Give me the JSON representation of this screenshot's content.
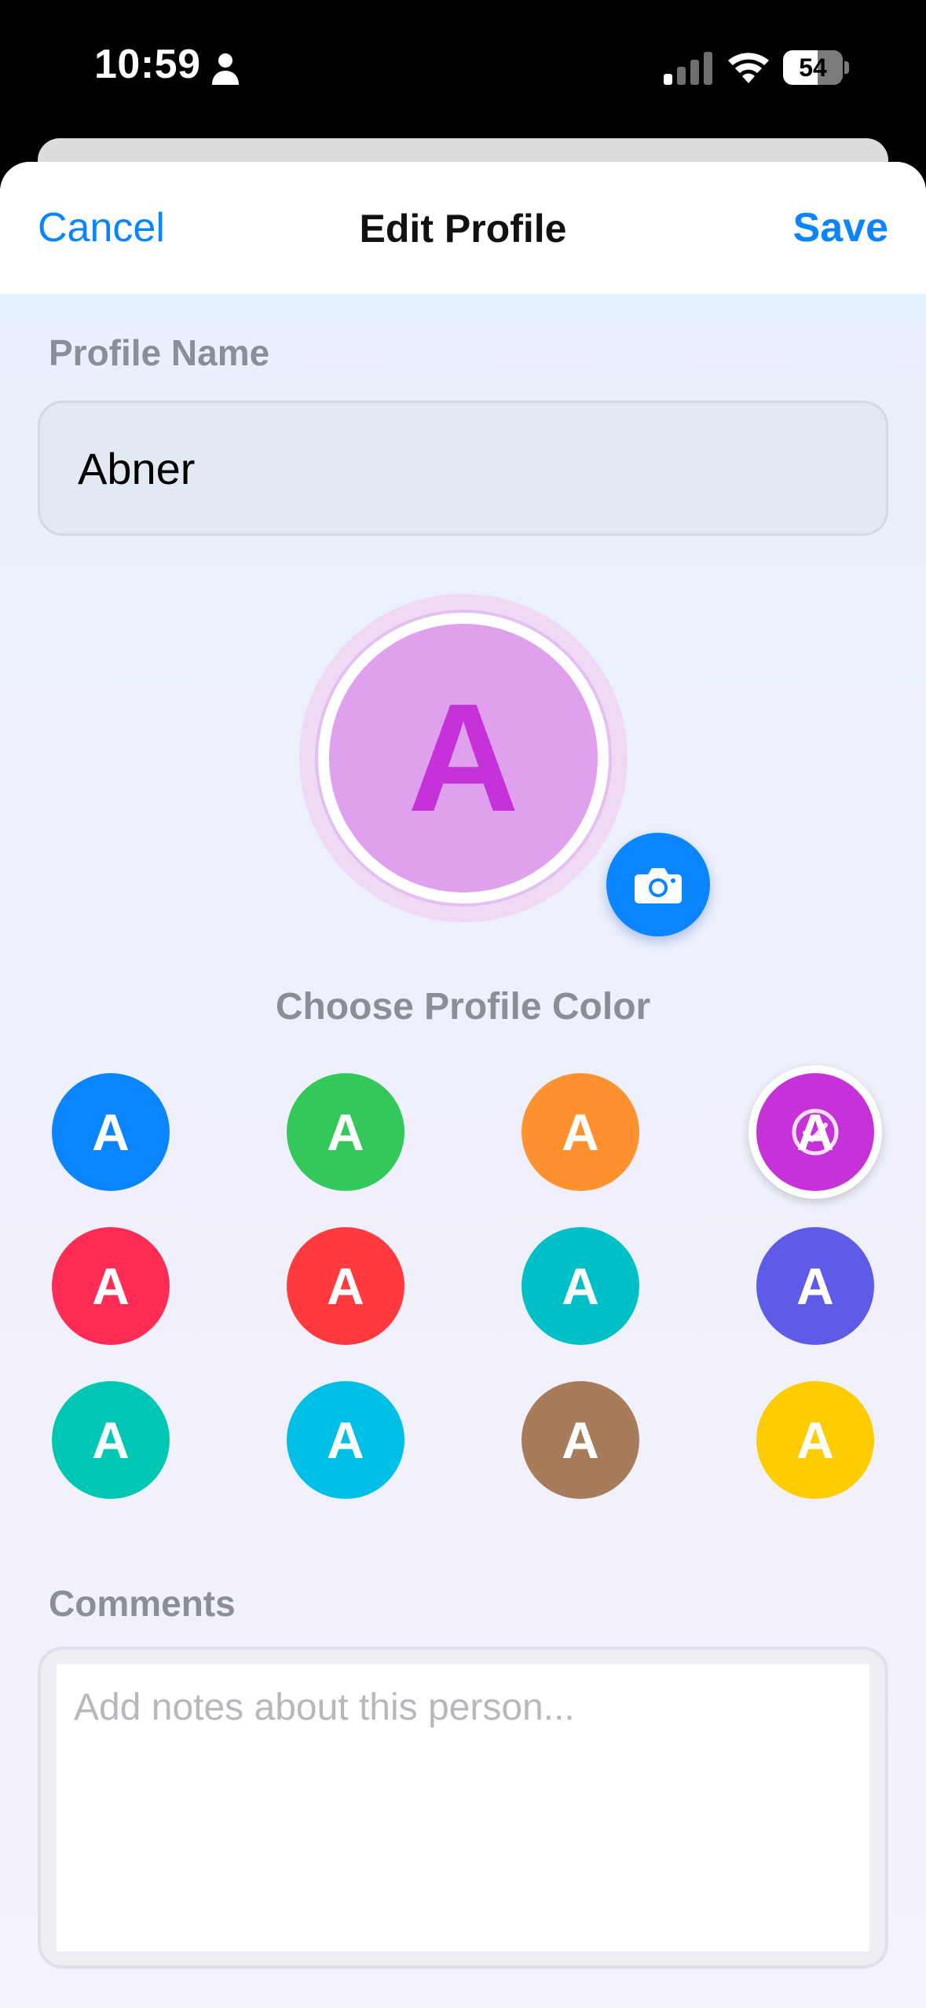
{
  "status_bar": {
    "time": "10:59",
    "battery": "54",
    "icons": [
      "person-icon",
      "cellular-signal-icon",
      "wifi-icon",
      "battery-icon"
    ]
  },
  "nav": {
    "cancel_label": "Cancel",
    "title": "Edit Profile",
    "save_label": "Save"
  },
  "profile_name": {
    "label": "Profile Name",
    "value": "Abner"
  },
  "avatar": {
    "letter": "A",
    "fill_color": "#dfa0ee",
    "letter_color": "#c532d8",
    "camera_icon": "camera-icon"
  },
  "color_picker": {
    "title": "Choose Profile Color",
    "selected_index": 3,
    "swatches": [
      {
        "letter": "A",
        "color": "#0a84ff"
      },
      {
        "letter": "A",
        "color": "#34c759"
      },
      {
        "letter": "A",
        "color": "#ff9230"
      },
      {
        "letter": "A",
        "color": "#c532d8"
      },
      {
        "letter": "A",
        "color": "#ff2d55"
      },
      {
        "letter": "A",
        "color": "#ff3b3f"
      },
      {
        "letter": "A",
        "color": "#00c0c7"
      },
      {
        "letter": "A",
        "color": "#5e5ce6"
      },
      {
        "letter": "A",
        "color": "#00c7b3"
      },
      {
        "letter": "A",
        "color": "#00bfe6"
      },
      {
        "letter": "A",
        "color": "#a67c5b"
      },
      {
        "letter": "A",
        "color": "#ffcc00"
      }
    ]
  },
  "comments": {
    "label": "Comments",
    "placeholder": "Add notes about this person..."
  }
}
